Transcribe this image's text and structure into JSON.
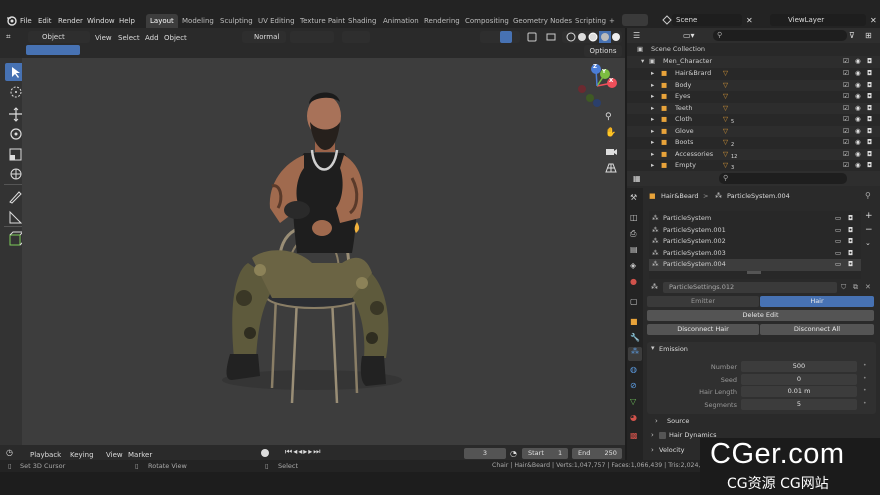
{
  "menus": [
    "File",
    "Edit",
    "Render",
    "Window",
    "Help"
  ],
  "workspaces": [
    "Layout",
    "Modeling",
    "Sculpting",
    "UV Editing",
    "Texture Paint",
    "Shading",
    "Animation",
    "Rendering",
    "Compositing",
    "Geometry Nodes",
    "Scripting"
  ],
  "active_workspace": "Layout",
  "plus": "+",
  "scene_label": "Scene",
  "viewlayer_label": "ViewLayer",
  "viewport_header": {
    "mode": "Object Mode",
    "items": [
      "View",
      "Select",
      "Add",
      "Object"
    ],
    "orientation": "Normal",
    "options": "Options"
  },
  "gizmo": {
    "x": "X",
    "y": "Y",
    "z": "Z"
  },
  "outliner": {
    "collection": "Scene Collection",
    "root": "Men_Character",
    "items": [
      "Hair&Brard",
      "Body",
      "Eyes",
      "Teeth",
      "Cloth",
      "Glove",
      "Boots",
      "Accessories",
      "Empty"
    ],
    "badges": [
      "",
      "",
      "",
      "",
      "5",
      "",
      "2",
      "12",
      "3"
    ]
  },
  "properties": {
    "breadcrumb_object": "Hair&Beard",
    "breadcrumb_sep": ">",
    "breadcrumb_system": "ParticleSystem.004",
    "systems": [
      "ParticleSystem",
      "ParticleSystem.001",
      "ParticleSystem.002",
      "ParticleSystem.003",
      "ParticleSystem.004"
    ],
    "settings_name": "ParticleSettings.012",
    "type_tabs": [
      "Emitter",
      "Hair"
    ],
    "delete_edit": "Delete Edit",
    "disconnect_hair": "Disconnect Hair",
    "disconnect_all": "Disconnect All",
    "emission_title": "Emission",
    "fields": [
      {
        "label": "Number",
        "value": "500"
      },
      {
        "label": "Seed",
        "value": "0"
      },
      {
        "label": "Hair Length",
        "value": "0.01 m"
      },
      {
        "label": "Segments",
        "value": "5"
      }
    ],
    "source": "Source",
    "hair_dynamics": "Hair Dynamics",
    "velocity": "Velocity"
  },
  "timeline": {
    "items": [
      "Playback",
      "Keying",
      "View",
      "Marker"
    ],
    "current_frame": "3",
    "start_label": "Start",
    "start": "1",
    "end_label": "End",
    "end": "250"
  },
  "status": {
    "left": "Set 3D Cursor",
    "mid": "Rotate View",
    "select": "Select",
    "stats": "Chair | Hair&Beard | Verts:1,047,757 | Faces:1,066,439 | Tris:2,024,386 |"
  },
  "watermark": {
    "main": "CGer.com",
    "sub": "CG资源 CG网站"
  },
  "colors": {
    "accent": "#4772b3",
    "orange": "#e8a33a",
    "viewport_bg": "#3d3d3d"
  }
}
